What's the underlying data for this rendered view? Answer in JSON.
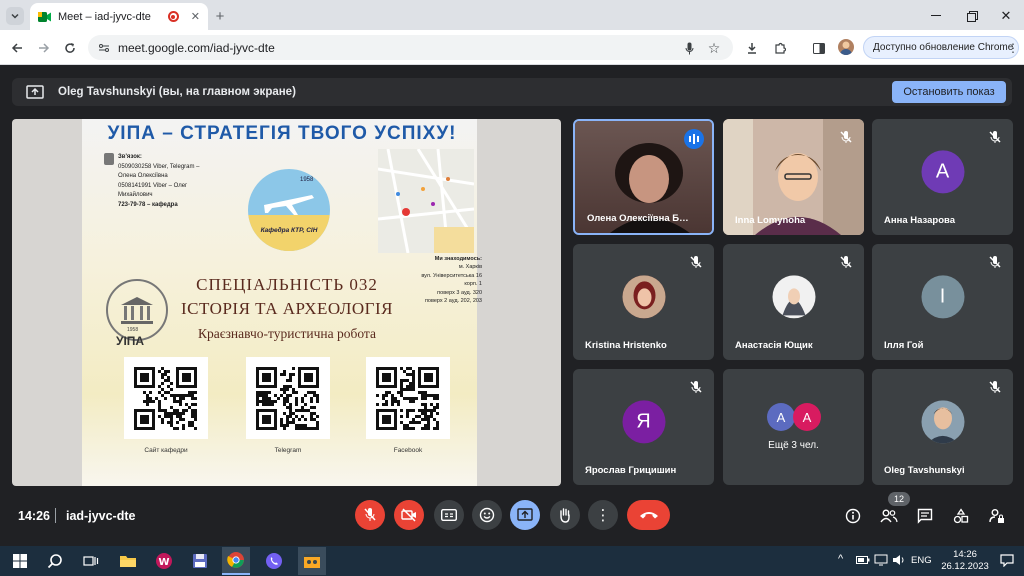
{
  "browser": {
    "tab_title": "Meet – iad-jyvc-dte",
    "url": "meet.google.com/iad-jyvc-dte",
    "update_button": "Доступно обновление Chrome"
  },
  "meet": {
    "presenting_text": "Oleg Tavshunskyi (вы, на главном экране)",
    "stop_button": "Остановить показ",
    "time": "14:26",
    "meeting_code": "iad-jyvc-dte",
    "participants_count": "12"
  },
  "slide": {
    "title": "УІПА – СТРАТЕГІЯ ТВОГО УСПІХУ!",
    "contacts_title": "Зв'язок:",
    "contacts": [
      "0509030258 Viber, Telegram –",
      "Олена Олексіївна",
      "0508141991 Viber – Олег",
      "Михайлович",
      "723-79-78 – кафедра"
    ],
    "logo_year": "1958",
    "logo_text": "Кафедра КТР, СІН",
    "address_title": "Ми знаходимось:",
    "address": [
      "м. Харків",
      "вул. Університетська 16",
      "корп. 1",
      "поверх 3 ауд. 320",
      "поверх 2 ауд. 202, 203"
    ],
    "specialty": "СПЕЦІАЛЬНІСТЬ 032",
    "specialty_name": "ІСТОРІЯ ТА АРХЕОЛОГІЯ",
    "specialty_sub": "Краєзнавчо-туристична робота",
    "uipa_label": "УІПА",
    "seal_year": "1958",
    "qr_labels": [
      "Сайт кафедри",
      "Telegram",
      "Facebook"
    ]
  },
  "participants": [
    {
      "name": "Олена Олексіївна Б…",
      "kind": "video",
      "speaking": true
    },
    {
      "name": "Inna Lomynoha",
      "kind": "video",
      "speaking": false
    },
    {
      "name": "Анна Назарова",
      "kind": "letter",
      "letter": "A",
      "color": "#6f3bb5"
    },
    {
      "name": "Kristina Hristenko",
      "kind": "photo"
    },
    {
      "name": "Анастасія Ющик",
      "kind": "photo"
    },
    {
      "name": "Ілля Гой",
      "kind": "letter",
      "letter": "I",
      "color": "#78909c"
    },
    {
      "name": "Ярослав Грицишин",
      "kind": "letter",
      "letter": "Я",
      "color": "#7b1fa2"
    },
    {
      "name": "Ещё 3 чел.",
      "kind": "more",
      "letters": [
        "A",
        "A"
      ]
    },
    {
      "name": "Oleg Tavshunskyi",
      "kind": "photo"
    }
  ],
  "taskbar": {
    "lang": "ENG",
    "clock_time": "14:26",
    "clock_date": "26.12.2023"
  },
  "colors": {
    "accent": "#8ab4f8",
    "danger": "#ea4335",
    "bg": "#202124"
  }
}
